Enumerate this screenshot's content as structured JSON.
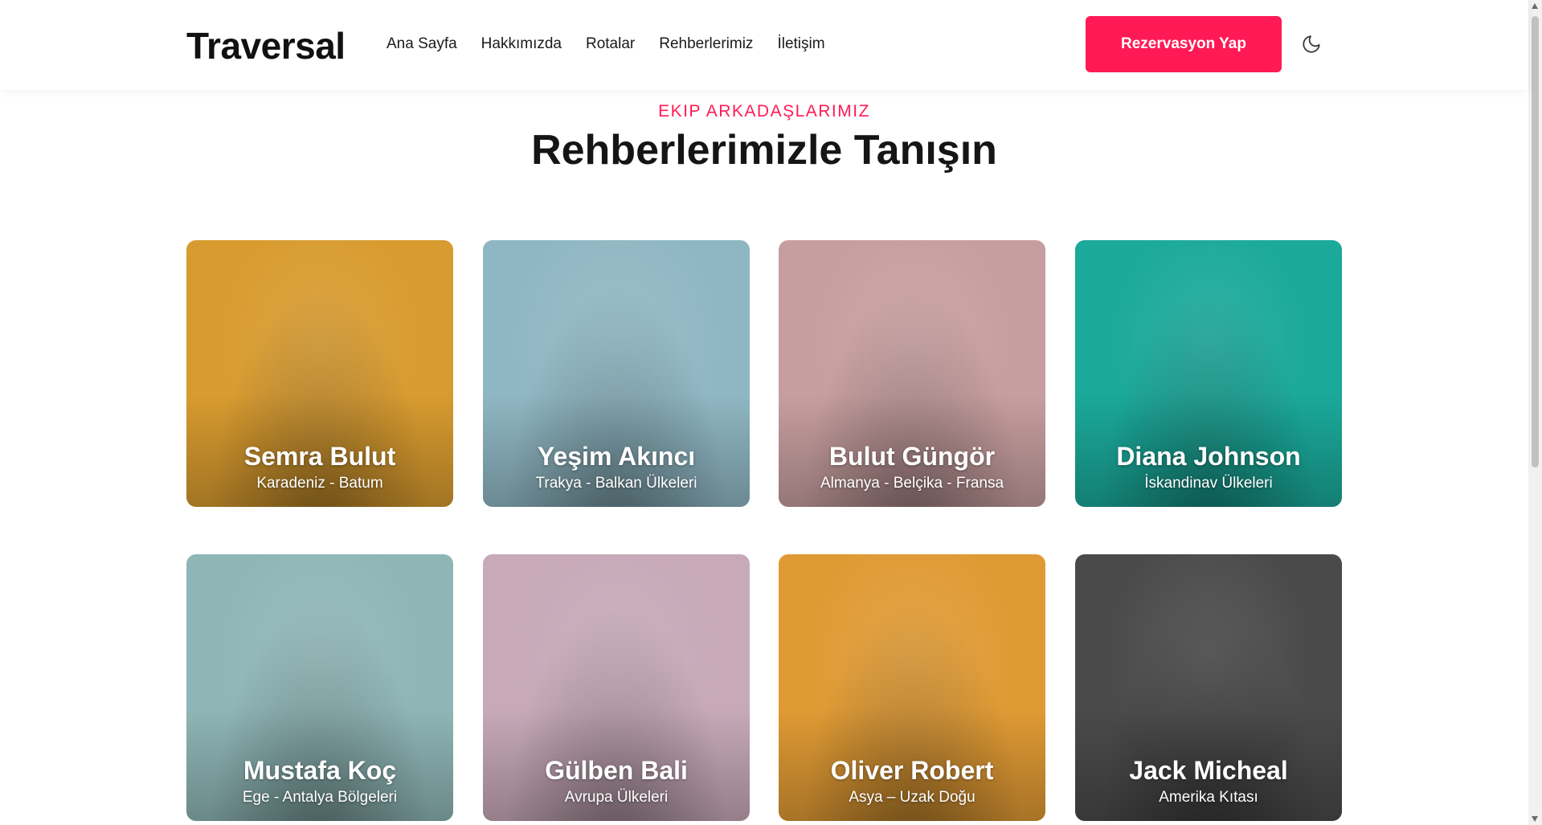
{
  "brand": "Traversal",
  "nav": [
    "Ana Sayfa",
    "Hakkımızda",
    "Rotalar",
    "Rehberlerimiz",
    "İletişim"
  ],
  "cta_label": "Rezervasyon Yap",
  "theme_icon": "moon-icon",
  "section": {
    "eyebrow": "EKIP ARKADAŞLARIMIZ",
    "title": "Rehberlerimizle Tanışın"
  },
  "guides": [
    {
      "name": "Semra Bulut",
      "region": "Karadeniz - Batum",
      "bg": "#d89b2f"
    },
    {
      "name": "Yeşim Akıncı",
      "region": "Trakya - Balkan Ülkeleri",
      "bg": "#8fb7c3"
    },
    {
      "name": "Bulut Güngör",
      "region": "Almanya - Belçika - Fransa",
      "bg": "#c79e9f"
    },
    {
      "name": "Diana Johnson",
      "region": "İskandinav Ülkeleri",
      "bg": "#1aa99a"
    },
    {
      "name": "Mustafa Koç",
      "region": "Ege - Antalya Bölgeleri",
      "bg": "#8fb6b6"
    },
    {
      "name": "Gülben Bali",
      "region": "Avrupa Ülkeleri",
      "bg": "#c7a9b8"
    },
    {
      "name": "Oliver Robert",
      "region": "Asya – Uzak Doğu",
      "bg": "#e09a34"
    },
    {
      "name": "Jack Micheal",
      "region": "Amerika Kıtası",
      "bg": "#4a4a4a"
    }
  ],
  "colors": {
    "accent": "#ff1a55"
  }
}
